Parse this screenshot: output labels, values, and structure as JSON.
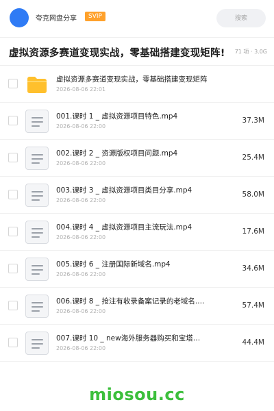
{
  "header": {
    "owner_name": "夸克网盘分享",
    "badge": "SVIP",
    "search_placeholder": "搜索"
  },
  "share": {
    "title": "虚拟资源多赛道变现实战，零基础搭建变现矩阵!",
    "meta": "71 项 · 3.0G"
  },
  "files": [
    {
      "type": "folder",
      "name": "虚拟资源多赛道变现实战，零基础搭建变现矩阵",
      "date": "2026-08-06 22:01",
      "size": ""
    },
    {
      "type": "video",
      "name": "001.课时 1 _ 虚拟资源项目特色.mp4",
      "date": "2026-08-06 22:00",
      "size": "37.3M"
    },
    {
      "type": "video",
      "name": "002.课时 2 _ 资源版权项目问题.mp4",
      "date": "2026-08-06 22:00",
      "size": "25.4M"
    },
    {
      "type": "video",
      "name": "003.课时 3 _ 虚拟资源项目类目分享.mp4",
      "date": "2026-08-06 22:00",
      "size": "58.0M"
    },
    {
      "type": "video",
      "name": "004.课时 4 _ 虚拟资源项目主流玩法.mp4",
      "date": "2026-08-06 22:00",
      "size": "17.6M"
    },
    {
      "type": "video",
      "name": "005.课时 6 _ 注册国际新域名.mp4",
      "date": "2026-08-06 22:00",
      "size": "34.6M"
    },
    {
      "type": "video",
      "name": "006.课时 8 _ 抢注有收录备案记录的老域名.…",
      "date": "2026-08-06 22:00",
      "size": "57.4M"
    },
    {
      "type": "video",
      "name": "007.课时 10 _ new海外服务器购买和宝塔…",
      "date": "2026-08-06 22:00",
      "size": "44.4M"
    }
  ],
  "footer": {
    "watermark": "miosou.cc"
  },
  "colors": {
    "avatar": "#2f7bf5",
    "badge": "#ffa12b",
    "folder": "#ffc02d",
    "watermark": "#3cbf3c"
  }
}
